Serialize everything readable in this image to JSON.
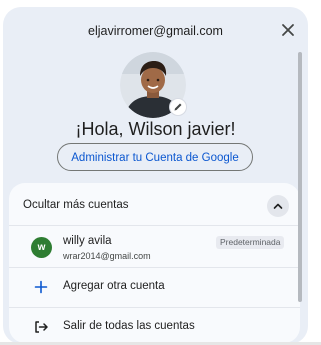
{
  "header": {
    "email": "eljavirromer@gmail.com",
    "close_icon": "close-icon"
  },
  "profile": {
    "greeting": "¡Hola, Wilson javier!",
    "manage_button": "Administrar tu Cuenta de Google",
    "edit_icon": "pencil-icon"
  },
  "accounts": {
    "toggle_label": "Ocultar más cuentas",
    "toggle_icon": "chevron-up-icon",
    "items": [
      {
        "initial": "w",
        "name": "willy avila",
        "email": "wrar2014@gmail.com",
        "badge": "Predeterminada",
        "avatar_color": "#2e7d32"
      }
    ],
    "add_account": {
      "label": "Agregar otra cuenta",
      "icon": "plus-icon"
    },
    "sign_out_all": {
      "label": "Salir de todas las cuentas",
      "icon": "logout-icon"
    }
  },
  "colors": {
    "panel": "#e9eef6",
    "card": "#f8fafd",
    "link": "#0b57d0"
  }
}
